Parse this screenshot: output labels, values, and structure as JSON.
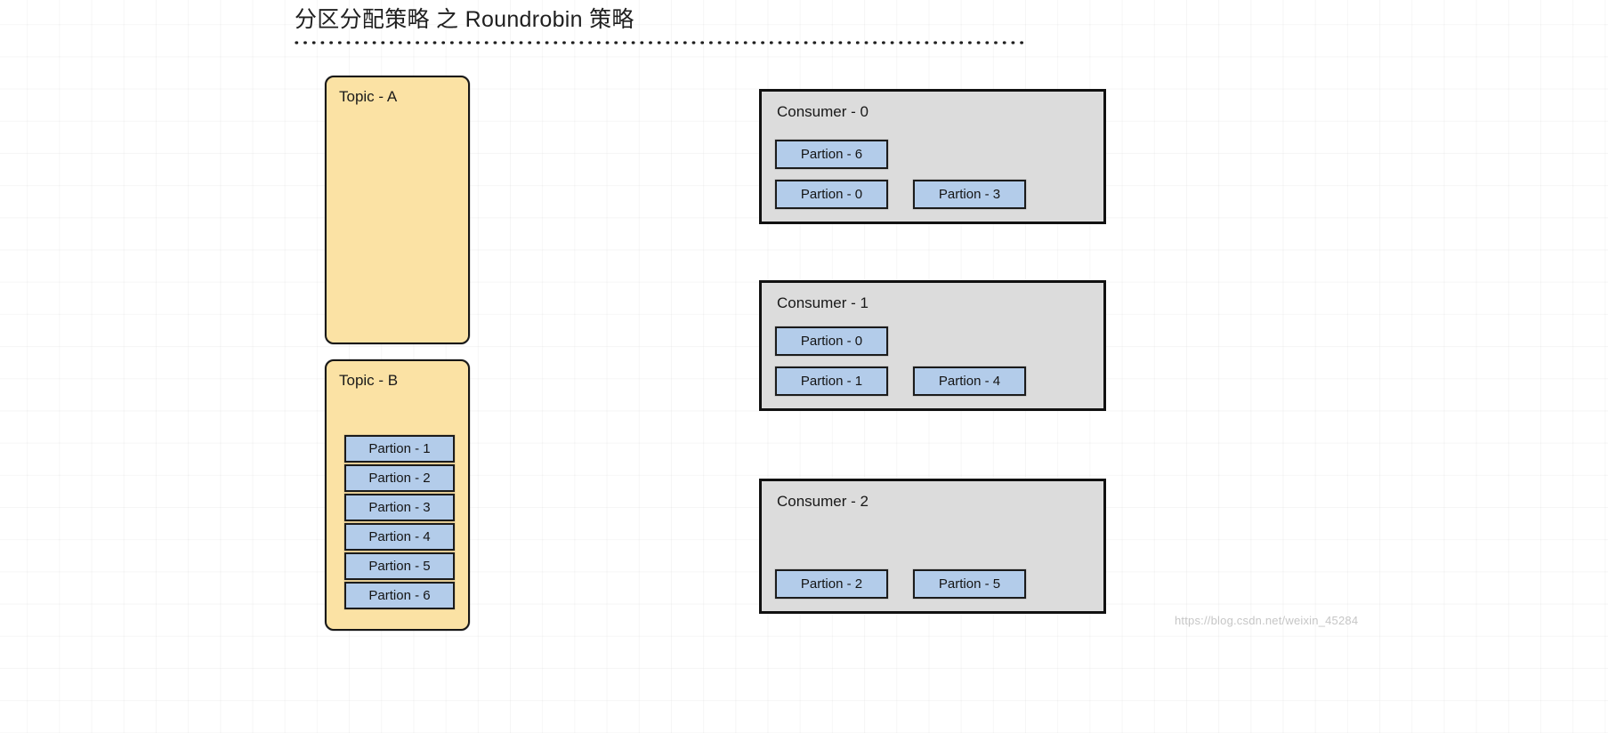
{
  "title": "分区分配策略 之 Roundrobin 策略",
  "colors": {
    "topic_fill": "#fbe2a4",
    "partition_fill": "#b3ccea",
    "consumer_fill": "#dcdcdc",
    "stroke": "#171717",
    "title_text": "#1f1f1f"
  },
  "topics": [
    {
      "id": "topic-a",
      "label": "Topic - A",
      "partitions": []
    },
    {
      "id": "topic-b",
      "label": "Topic - B",
      "partitions": [
        "Partion - 1",
        "Partion - 2",
        "Partion - 3",
        "Partion - 4",
        "Partion - 5",
        "Partion - 6"
      ]
    }
  ],
  "consumers": [
    {
      "id": "consumer-0",
      "label": "Consumer - 0",
      "rows": [
        [
          "Partion - 6"
        ],
        [
          "Partion - 0",
          "Partion - 3"
        ]
      ]
    },
    {
      "id": "consumer-1",
      "label": "Consumer - 1",
      "rows": [
        [
          "Partion - 0"
        ],
        [
          "Partion - 1",
          "Partion - 4"
        ]
      ]
    },
    {
      "id": "consumer-2",
      "label": "Consumer - 2",
      "rows": [
        [],
        [
          "Partion - 2",
          "Partion - 5"
        ]
      ]
    }
  ],
  "watermark": "https://blog.csdn.net/weixin_45284"
}
